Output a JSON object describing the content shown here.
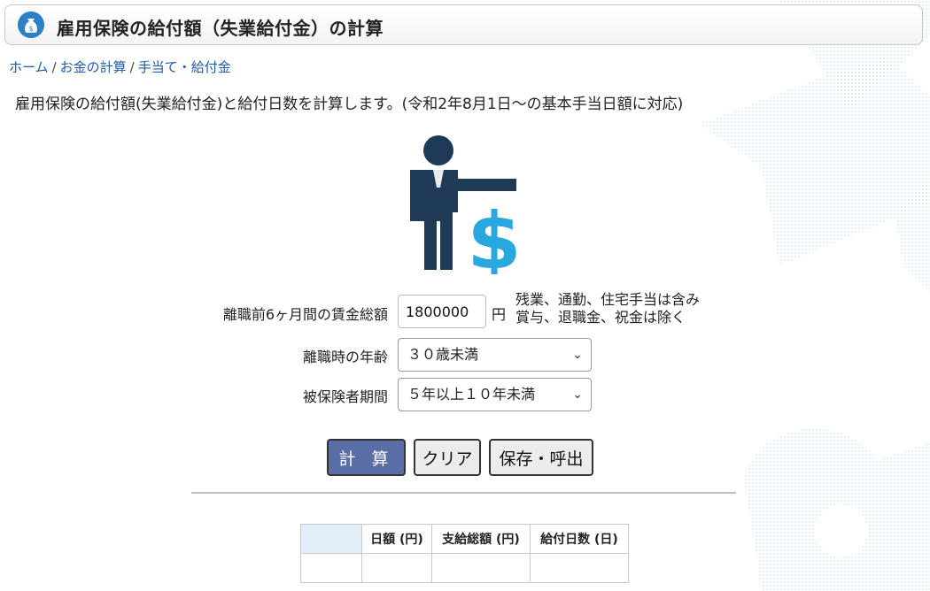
{
  "page": {
    "title": "雇用保険の給付額（失業給付金）の計算",
    "description": "雇用保険の給付額(失業給付金)と給付日数を計算します。(令和2年8月1日～の基本手当日額に対応)"
  },
  "breadcrumb": [
    {
      "label": "ホーム"
    },
    {
      "label": "お金の計算"
    },
    {
      "label": "手当て・給付金"
    }
  ],
  "breadcrumb_sep": "/",
  "form": {
    "wage": {
      "label": "離職前6ヶ月間の賃金総額",
      "value": "1800000",
      "unit": "円",
      "note_line1": "残業、通勤、住宅手当は含み",
      "note_line2": "賞与、退職金、祝金は除く"
    },
    "age": {
      "label": "離職時の年齢",
      "value": "３０歳未満"
    },
    "period": {
      "label": "被保険者期間",
      "value": "５年以上１０年未満"
    }
  },
  "buttons": {
    "calc": "計 算",
    "clear": "クリア",
    "save": "保存・呼出"
  },
  "result_table": {
    "headers": [
      "",
      "日額 (円)",
      "支給総額 (円)",
      "給付日数 (日)"
    ],
    "rows": [
      [
        "",
        "",
        "",
        ""
      ]
    ]
  },
  "colors": {
    "accent": "#5a6ea6",
    "icon_dark": "#1e3a56",
    "icon_light": "#29a8e0",
    "link": "#1f5aa6"
  },
  "icons": {
    "title": "money-bag-icon",
    "hero": "person-dollar-icon"
  }
}
